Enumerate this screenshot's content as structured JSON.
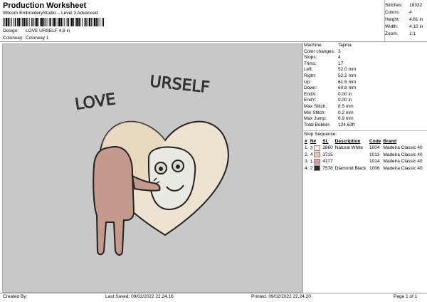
{
  "header": {
    "title": "Production Worksheet",
    "subtitle": "Wilcom EmbroideryStudio – Level 3 Advanced"
  },
  "design_info": {
    "design_label": "Design:",
    "design_value": "LOVE URSELF 4,8 in",
    "colorway_label": "Colorway:",
    "colorway_value": "Colorway 1"
  },
  "stats": [
    {
      "label": "Stitches:",
      "value": "18332"
    },
    {
      "label": "Colors:",
      "value": "4"
    },
    {
      "label": "Height:",
      "value": "4.81 in"
    },
    {
      "label": "Width:",
      "value": "4.10 in"
    },
    {
      "label": "Zoom:",
      "value": "1:1"
    }
  ],
  "machine": [
    {
      "label": "Machine:",
      "value": "Tajima"
    },
    {
      "label": "Color changes:",
      "value": "3"
    },
    {
      "label": "Stops:",
      "value": "4"
    },
    {
      "label": "Trims:",
      "value": "17"
    },
    {
      "label": "Left:",
      "value": "52.0 mm"
    },
    {
      "label": "Right:",
      "value": "52.2 mm"
    },
    {
      "label": "Up:",
      "value": "61.5 mm"
    },
    {
      "label": "Down:",
      "value": "60.8 mm"
    },
    {
      "label": "EndX:",
      "value": "0.00 in"
    },
    {
      "label": "EndY:",
      "value": "0.00 in"
    },
    {
      "label": "Max Stitch:",
      "value": "8.5 mm"
    },
    {
      "label": "Min Stitch:",
      "value": "0.2 mm"
    },
    {
      "label": "Max Jump:",
      "value": "6.9 mm"
    },
    {
      "label": "Total Bobbin:",
      "value": "124.63ft"
    }
  ],
  "stop_sequence": {
    "label": "Stop Sequence:",
    "headers": [
      "#",
      "N#",
      "St.",
      "Description",
      "Code",
      "Brand"
    ],
    "rows": [
      {
        "num": "1.",
        "n": "3",
        "color": "#f1ede4",
        "st": "2860",
        "desc": "Natural White",
        "code": "1004",
        "brand": "Madeira Classic 40"
      },
      {
        "num": "2.",
        "n": "4",
        "color": "#e8c8b4",
        "st": "3715",
        "desc": "",
        "code": "1013",
        "brand": "Madeira Classic 40"
      },
      {
        "num": "3.",
        "n": "1",
        "color": "#d79a9e",
        "st": "4177",
        "desc": "",
        "code": "1014",
        "brand": "Madeira Classic 40"
      },
      {
        "num": "4.",
        "n": "2",
        "color": "#2a2a2a",
        "st": "7578",
        "desc": "Diamond Black",
        "code": "1006",
        "brand": "Madeira Classic 40"
      }
    ]
  },
  "artwork": {
    "text": "LOVE URSELF"
  },
  "footer": {
    "created_by": "Created By:",
    "last_saved": "Last Saved: 09/02/2022 22.24.16",
    "printed": "Printed: 09/02/2022 22.24.20",
    "page": "Page 1 of 1"
  }
}
